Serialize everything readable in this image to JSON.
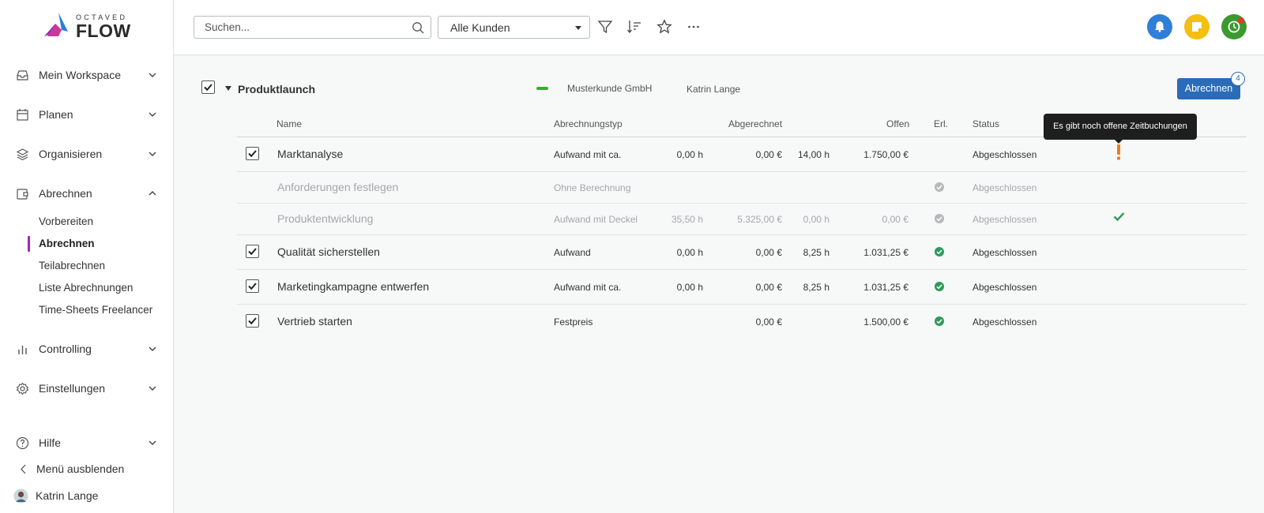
{
  "app": {
    "logo_small": "OCTAVED",
    "logo_big": "FLOW"
  },
  "sidebar": {
    "items": [
      {
        "label": "Mein Workspace",
        "icon": "inbox-icon"
      },
      {
        "label": "Planen",
        "icon": "calendar-icon"
      },
      {
        "label": "Organisieren",
        "icon": "layers-icon"
      },
      {
        "label": "Abrechnen",
        "icon": "invoice-icon"
      },
      {
        "label": "Controlling",
        "icon": "bar-chart-icon"
      },
      {
        "label": "Einstellungen",
        "icon": "gear-icon"
      }
    ],
    "subitems": [
      "Vorbereiten",
      "Abrechnen",
      "Teilabrechnen",
      "Liste Abrechnungen",
      "Time-Sheets Freelancer"
    ],
    "active_subitem": "Abrechnen",
    "help": "Hilfe",
    "hide_menu": "Menü ausblenden",
    "user": "Katrin Lange"
  },
  "toolbar": {
    "search_placeholder": "Suchen...",
    "customer_filter": "Alle Kunden",
    "icons": [
      "filter-icon",
      "sort-icon",
      "star-icon",
      "more-icon"
    ],
    "right_buttons": [
      {
        "icon": "bell-icon",
        "color": "#2f7fd8"
      },
      {
        "icon": "note-icon",
        "color": "#f3bf10"
      },
      {
        "icon": "timer-icon",
        "color": "#3b9a2f"
      }
    ]
  },
  "group": {
    "title": "Produktlaunch",
    "client": "Musterkunde GmbH",
    "person": "Katrin Lange",
    "bill_button": "Abrechnen",
    "badge_count": "4",
    "client_color": "#3bac2e"
  },
  "table": {
    "columns": {
      "name": "Name",
      "billing_type": "Abrechnungstyp",
      "billed": "Abgerechnet",
      "open": "Offen",
      "done": "Erl.",
      "status": "Status"
    },
    "rows": [
      {
        "name": "Marktanalyse",
        "type": "Aufwand mit ca.",
        "billed_h": "0,00 h",
        "billed_eur": "0,00 €",
        "open_h": "14,00 h",
        "open_eur": "1.750,00 €",
        "done": "",
        "status": "Abgeschlossen",
        "checked": true,
        "dim": false
      },
      {
        "name": "Anforderungen festlegen",
        "type": "Ohne Berechnung",
        "billed_h": "",
        "billed_eur": "",
        "open_h": "",
        "open_eur": "",
        "done": "grey",
        "status": "Abgeschlossen",
        "checked": false,
        "dim": true
      },
      {
        "name": "Produktentwicklung",
        "type": "Aufwand mit Deckel",
        "billed_h": "35,50 h",
        "billed_eur": "5.325,00 €",
        "open_h": "0,00 h",
        "open_eur": "0,00 €",
        "done": "grey",
        "status": "Abgeschlossen",
        "checked": false,
        "dim": true
      },
      {
        "name": "Qualität sicherstellen",
        "type": "Aufwand",
        "billed_h": "0,00 h",
        "billed_eur": "0,00 €",
        "open_h": "8,25 h",
        "open_eur": "1.031,25 €",
        "done": "green",
        "status": "Abgeschlossen",
        "checked": true,
        "dim": false
      },
      {
        "name": "Marketingkampagne entwerfen",
        "type": "Aufwand mit ca.",
        "billed_h": "0,00 h",
        "billed_eur": "0,00 €",
        "open_h": "8,25 h",
        "open_eur": "1.031,25 €",
        "done": "green",
        "status": "Abgeschlossen",
        "checked": true,
        "dim": false
      },
      {
        "name": "Vertrieb starten",
        "type": "Festpreis",
        "billed_h": "",
        "billed_eur": "0,00 €",
        "open_h": "",
        "open_eur": "1.500,00 €",
        "done": "green",
        "status": "Abgeschlossen",
        "checked": true,
        "dim": false
      }
    ]
  },
  "tooltip": "Es gibt noch offene Zeitbuchungen",
  "colors": {
    "accent": "#2a6cb8",
    "active_nav": "#9b2bb8",
    "done_green": "#2f9a5a",
    "warning": "#f07a1a"
  }
}
